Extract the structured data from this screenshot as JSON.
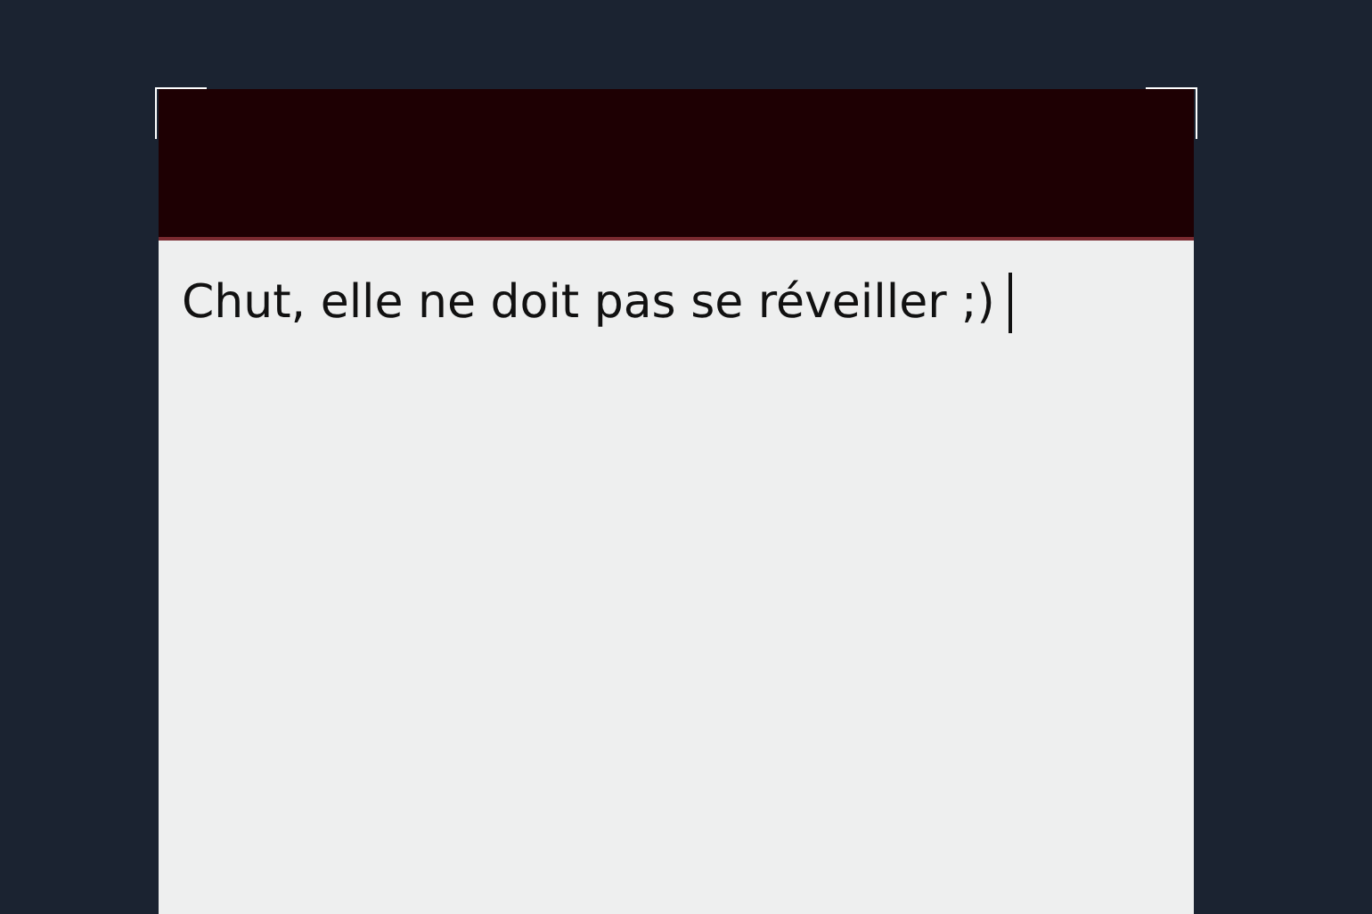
{
  "note": {
    "text": "Chut, elle ne doit pas se réveiller ;)"
  }
}
